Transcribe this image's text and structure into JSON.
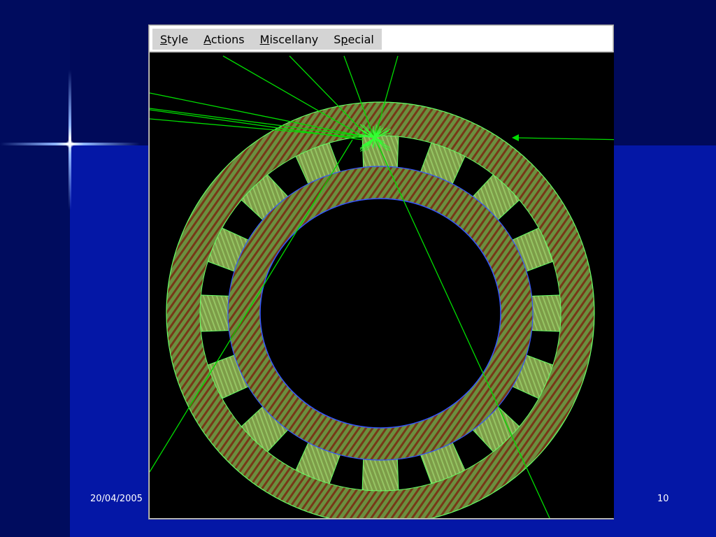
{
  "menu": {
    "items": [
      {
        "mnemonic": "S",
        "rest": "tyle"
      },
      {
        "mnemonic": "A",
        "rest": "ctions"
      },
      {
        "mnemonic": "M",
        "rest": "iscellany"
      },
      {
        "pre": "S",
        "mnemonic": "p",
        "rest": "ecial"
      }
    ]
  },
  "footer": {
    "date": "20/04/2005",
    "page_number": "10"
  },
  "colors": {
    "slide_background": "#0417a6",
    "detector_fill": "#6b8f3e",
    "detector_stripe": "#7a1a0a",
    "detector_edge": "#66ff66",
    "track_color": "#00dd00",
    "outline_color": "#3355ff"
  },
  "icons": {
    "star": "sparkle-star"
  }
}
